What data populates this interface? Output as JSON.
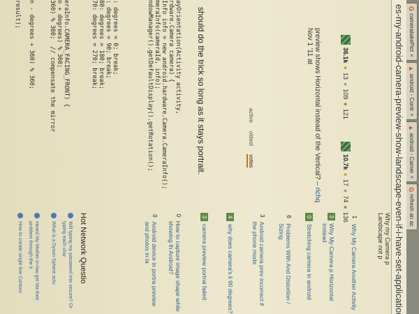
{
  "browser": {
    "tabs": [
      {
        "label": "cameratakePict",
        "close": "×"
      },
      {
        "label": "android - Contr",
        "close": "×"
      },
      {
        "label": "android - Camer",
        "close": "×"
      },
      {
        "label": "refresh an ac",
        "close": ""
      }
    ],
    "url": "es-my-android-camera-preview-show-landscape-even-if-i-have-set-application"
  },
  "question": {
    "user1": {
      "rep": "36.1k",
      "gold": "13",
      "silver": "109",
      "bronze": "121"
    },
    "user2": {
      "rep": "10.7k",
      "gold": "17",
      "silver": "74",
      "bronze": "136"
    }
  },
  "comment": {
    "text": "preview shows Horizontal instead of the Vertical?",
    "sep": " – ",
    "author": "rlchq",
    "date": "Nov 1 '11 at"
  },
  "answer_tabs": {
    "active": "active",
    "oldest": "oldest",
    "votes": "votes"
  },
  "answer": {
    "text": "should do the trick so long as it stays portrait.",
    "code": [
      "ayOrientation(Activity activity,",
      "rdware.Camera camera) {",
      "Info info = new android.hardware.Camera.CameraInfo();",
      "meraInfo(cameraId, info);",
      "ndowManager().getDefaultDisplay().getRotation();",
      "",
      "",
      "",
      "",
      ": degrees = 0; break;",
      ": degrees = 90; break;",
      "80: degrees = 180; break;",
      "70: degrees = 270; break;",
      "",
      "",
      "",
      "eraInfo.CAMERA_FACING_FRONT) {",
      "n + degrees) % 360;",
      "360) % 360;  // compensate the mirror",
      "",
      "",
      "n - degrees + 360) % 360;",
      "",
      "result);"
    ]
  },
  "sidebar": {
    "top_text": [
      "Why my Camera p",
      "Landscape not p"
    ],
    "linked": [
      {
        "num": "1",
        "title": "Why My Camera Another Activity"
      },
      {
        "num": "3",
        "title": "Why My Camera p Horizontal instead"
      },
      {
        "num": "0",
        "title": "Stretching camera in android"
      },
      {
        "num": "6",
        "title": "Problems With And Distortion / Sizing"
      },
      {
        "num": "3",
        "title": "Android camera prev incorrect if the phone mode"
      },
      {
        "num": "4",
        "title": "why does camera's li 90 degrees?"
      },
      {
        "num": "3",
        "title": "camera preview portrai failed"
      },
      {
        "num": "0",
        "title": "How to capture image shape while showing th Android?"
      },
      {
        "num": "0",
        "title": "Android device in portra preview and photos in la"
      }
    ],
    "hnq_title": "Hot Network Questio",
    "hnq": [
      "Will typing my password into secure? Or typing each char",
      "What is a Dyson Sphere actu",
      "Heard My Mother-in-law get Ma their problem through the ti",
      "How to create single line Contour"
    ]
  }
}
